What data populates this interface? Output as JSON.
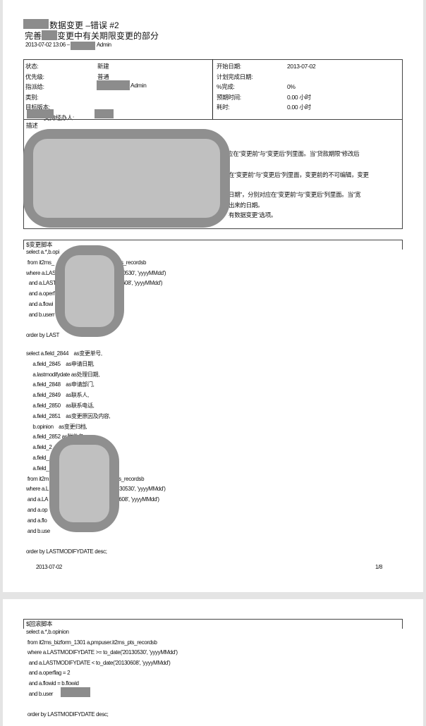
{
  "header": {
    "title": "数据变更 –错误 #2",
    "subtitle_pre": "完善",
    "subtitle_post": "变更中有关期限变更的部分",
    "meta_pre": "2013-07-02 13:06 –",
    "meta_user": "Admin"
  },
  "fields_left": [
    {
      "label": "状态:",
      "value": "新建"
    },
    {
      "label": "优先级:",
      "value": "普通"
    },
    {
      "label": "指派给:",
      "value": "Admin"
    },
    {
      "label": "类别:",
      "value": ""
    },
    {
      "label": "目标版本:",
      "value": ""
    },
    {
      "label": "支持经办人:",
      "value": ""
    }
  ],
  "fields_right": [
    {
      "label": "开始日期:",
      "value": "2013-07-02"
    },
    {
      "label": "计划完成日期:",
      "value": ""
    },
    {
      "label": "%完成:",
      "value": "0%"
    },
    {
      "label": "预期时间:",
      "value": "0.00 小时"
    },
    {
      "label": "耗时:",
      "value": "0.00 小时"
    }
  ],
  "description": {
    "label": "描述",
    "lines": [
      "应在”变更前“与”变更后“列里面。当”贷款期限“修改后",
      "在”变更前“与”变更后“列里面，变更前的不可编辑，变更",
      "日期”，分别对应在”变更前“与”变更后“列里面。当”宽",
      "出来的日期。",
      "有数据变更”选项。"
    ]
  },
  "change_script": {
    "label": "$变更脚本",
    "block1": "select a.*,b.opi\n from it2ms_                                           s_pts_recordsb\nwhere a.LAS                                        ('20130530', 'yyyyMMdd')\n  and a.LAST                                       20130608', 'yyyyMMdd')\n  and a.operf\n  and a.flowi\n  and b.userr\n\norder by LAST",
    "block2": "select a.field_2844    as变更单号,\n     a.field_2845    as申请日期,\n     a.lastmodifydate as处理日期,\n     a.field_2848    as申请部门,\n     a.field_2849    as联系人,\n     a.field_2850    as联系电话,\n     a.field_2851    as变更原因及内容,\n     b.opinion    as变更归档,\n     a.field_2852 as附件名,\n     a.field_2\n     a.field_\n     a.field_\n from it2m                                        2ms_pts_recordsb\nwhere a.L                                          te('20130530', 'yyyyMMdd')\n and a.LA                                         ('20130608', 'yyyyMMdd')\n and a.op\n and a.flo\n and b.use\n\norder by LASTMODIFYDATE desc;"
  },
  "footer": {
    "date": "2013-07-02",
    "page": "1/8"
  },
  "rollback_script": {
    "label": "$回滚脚本",
    "block": "select a.*,b.opinion\n from it2ms_bizform_1301 a,pmpuser.it2ms_pts_recordsb\n where a.LASTMODIFYDATE >= to_date('20130530', 'yyyyMMdd')\n  and a.LASTMODIFYDATE < to_date('20130608', 'yyyyMMdd')\n  and a.operflag = 2\n  and a.flowid = b.flowid\n  and b.user\n\n order by LASTMODIFYDATE desc;"
  }
}
